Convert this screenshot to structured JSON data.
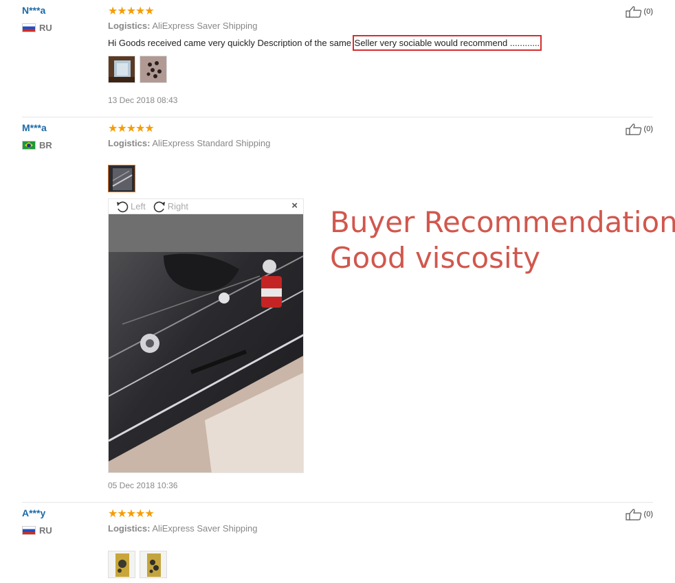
{
  "reviews": [
    {
      "user": "N***a",
      "country": "RU",
      "stars": "★★★★★",
      "logistics_label": "Logistics:",
      "logistics_value": "AliExpress Saver Shipping",
      "feedback_plain": "Hi Goods received came very quickly Description of the same ",
      "feedback_highlight": "Seller very sociable would recommend ............",
      "date": "13 Dec 2018 08:43",
      "likes": "(0)"
    },
    {
      "user": "M***a",
      "country": "BR",
      "stars": "★★★★★",
      "logistics_label": "Logistics:",
      "logistics_value": "AliExpress Standard Shipping",
      "date": "05 Dec 2018 10:36",
      "likes": "(0)",
      "viewer": {
        "left_label": "Left",
        "right_label": "Right",
        "close": "×"
      }
    },
    {
      "user": "A***y",
      "country": "RU",
      "stars": "★★★★★",
      "logistics_label": "Logistics:",
      "logistics_value": "AliExpress Saver Shipping",
      "likes": "(0)"
    }
  ],
  "annotation": {
    "line1": "Buyer Recommendation",
    "line2": "Good viscosity"
  },
  "colors": {
    "star": "#f59d07",
    "username": "#1a6aa8",
    "highlight_border": "#d32d2d",
    "annotation": "#d1574d"
  }
}
